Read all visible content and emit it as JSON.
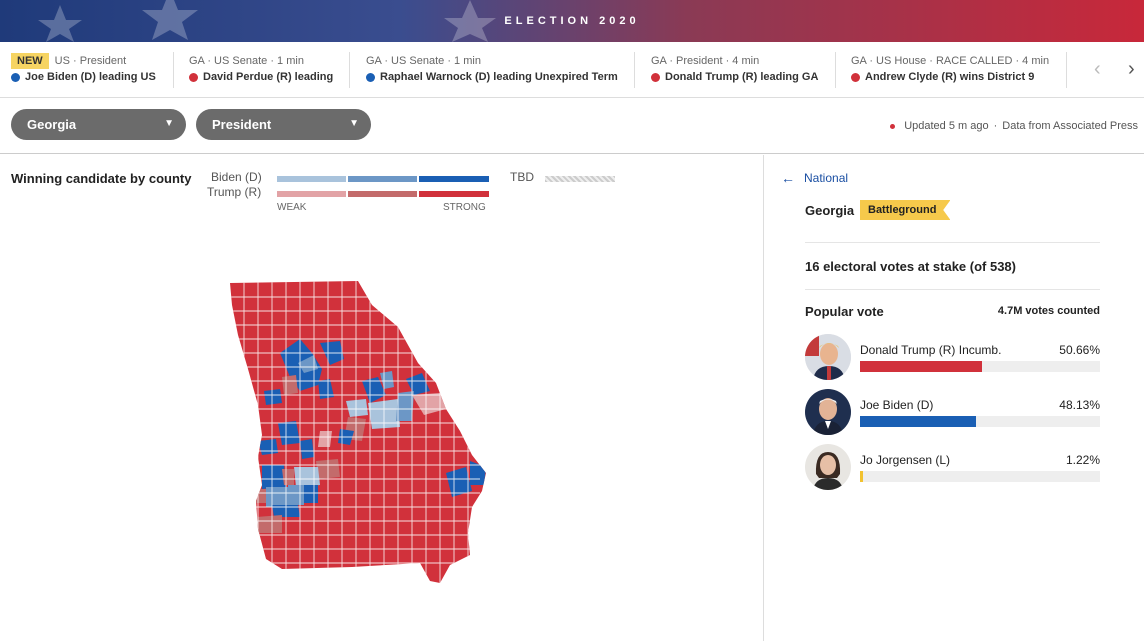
{
  "banner": {
    "title": "ELECTION 2020"
  },
  "ticker": {
    "items": [
      {
        "badge": "NEW",
        "meta": "US · President",
        "headline": "Joe Biden (D) leading US",
        "color": "#1a5fb4"
      },
      {
        "badge": "",
        "meta": "GA · US Senate · 1 min",
        "headline": "David Perdue (R) leading",
        "color": "#d1313b"
      },
      {
        "badge": "",
        "meta": "GA · US Senate · 1 min",
        "headline": "Raphael Warnock (D) leading Unexpired Term",
        "color": "#1a5fb4"
      },
      {
        "badge": "",
        "meta": "GA · President · 4 min",
        "headline": "Donald Trump (R) leading GA",
        "color": "#d1313b"
      },
      {
        "badge": "",
        "meta": "GA · US House · RACE CALLED · 4 min",
        "headline": "Andrew Clyde (R) wins District 9",
        "color": "#d1313b"
      }
    ],
    "prev_icon": "chevron-left-icon",
    "next_icon": "chevron-right-icon"
  },
  "controls": {
    "state_select": "Georgia",
    "race_select": "President",
    "updated": "Updated 5 m ago",
    "source": "Data from Associated Press"
  },
  "map": {
    "title": "Winning candidate by county",
    "legend": {
      "biden_label": "Biden (D)",
      "trump_label": "Trump (R)",
      "weak_label": "WEAK",
      "strong_label": "STRONG",
      "tbd_label": "TBD",
      "biden_colors": [
        "#a9c3dc",
        "#6c97c6",
        "#1a5fb4"
      ],
      "trump_colors": [
        "#e2a3a6",
        "#c36b6b",
        "#d1313b"
      ]
    }
  },
  "panel": {
    "back_label": "National",
    "state": "Georgia",
    "badge": "Battleground",
    "electoral_text": "16 electoral votes at stake (of 538)",
    "popular_title": "Popular vote",
    "votes_counted": "4.7M votes counted",
    "candidates": [
      {
        "name": "Donald Trump",
        "party": "(R)",
        "note": "Incumb.",
        "pct_text": "50.66%",
        "share": 0.5066,
        "color": "#d1313b"
      },
      {
        "name": "Joe Biden",
        "party": "(D)",
        "note": "",
        "pct_text": "48.13%",
        "share": 0.4813,
        "color": "#1a5fb4"
      },
      {
        "name": "Jo Jorgensen",
        "party": "(L)",
        "note": "",
        "pct_text": "1.22%",
        "share": 0.0122,
        "color": "#f2c230"
      }
    ]
  }
}
